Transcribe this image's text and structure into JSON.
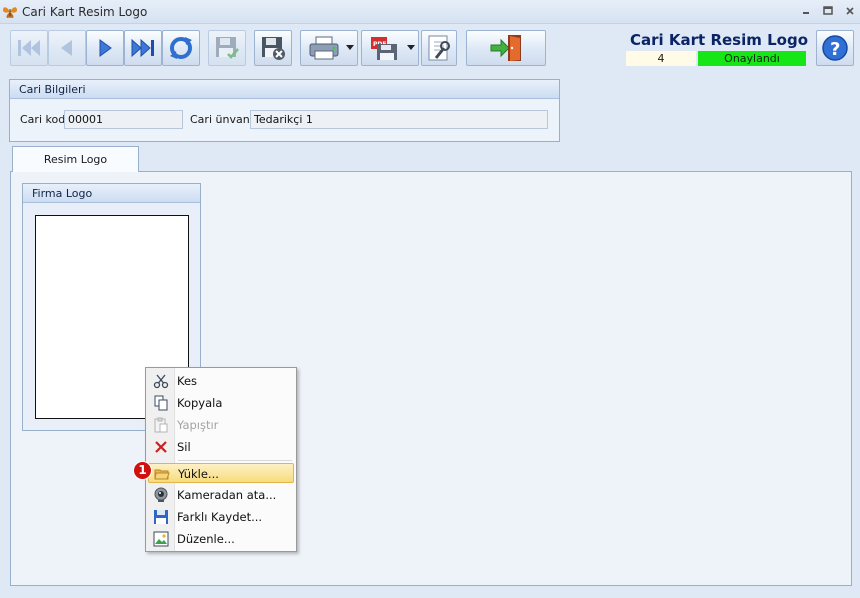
{
  "window": {
    "title": "Cari Kart Resim Logo",
    "controls": [
      "minimize",
      "maximize",
      "close"
    ]
  },
  "toolbar": {
    "buttons": [
      {
        "name": "first-record",
        "icon": "skip-first-icon"
      },
      {
        "name": "previous-record",
        "icon": "arrow-left-icon"
      },
      {
        "name": "next-record",
        "icon": "arrow-right-icon"
      },
      {
        "name": "last-record",
        "icon": "skip-last-icon"
      },
      {
        "name": "refresh",
        "icon": "refresh-icon"
      },
      {
        "name": "save",
        "icon": "floppy-check-icon"
      },
      {
        "name": "cancel-save",
        "icon": "floppy-cancel-icon"
      },
      {
        "name": "print",
        "icon": "printer-icon"
      },
      {
        "name": "export-pdf",
        "icon": "pdf-save-icon"
      },
      {
        "name": "tools",
        "icon": "wrench-document-icon"
      },
      {
        "name": "exit",
        "icon": "exit-door-icon"
      }
    ]
  },
  "header": {
    "title": "Cari Kart Resim Logo",
    "record_number": "4",
    "status": "Onaylandı",
    "status_color": "#16e616",
    "help_icon": "help-icon"
  },
  "cari_bilgileri": {
    "title": "Cari Bilgileri",
    "cari_kod_label": "Cari kod",
    "cari_kod_value": "00001",
    "cari_unvani_label": "Cari ünvanı",
    "cari_unvani_value": "Tedarikçi 1"
  },
  "tabs": [
    {
      "label": "Resim Logo",
      "active": true
    }
  ],
  "firma_logo": {
    "title": "Firma Logo"
  },
  "context_menu": {
    "items": [
      {
        "label": "Kes",
        "icon": "scissors-icon",
        "enabled": true
      },
      {
        "label": "Kopyala",
        "icon": "copy-icon",
        "enabled": true
      },
      {
        "label": "Yapıştır",
        "icon": "paste-icon",
        "enabled": false
      },
      {
        "label": "Sil",
        "icon": "delete-x-icon",
        "enabled": true
      },
      {
        "label": "Yükle...",
        "icon": "folder-open-icon",
        "enabled": true,
        "highlighted": true
      },
      {
        "label": "Kameradan ata...",
        "icon": "webcam-icon",
        "enabled": true
      },
      {
        "label": "Farklı Kaydet...",
        "icon": "floppy-icon",
        "enabled": true
      },
      {
        "label": "Düzenle...",
        "icon": "image-edit-icon",
        "enabled": true
      }
    ]
  },
  "annotation": {
    "step": "1",
    "color": "#d11010"
  }
}
